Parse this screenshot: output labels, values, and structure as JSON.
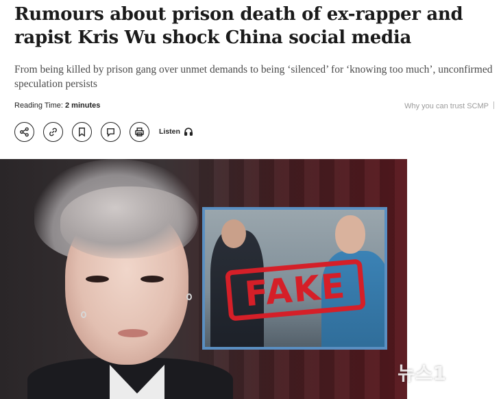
{
  "article": {
    "headline": "Rumours about prison death of ex-rapper and rapist Kris Wu shock China social media",
    "subheadline": "From being killed by prison gang over unmet demands to being ‘silenced’ for ‘knowing too much’, unconfirmed speculation persists",
    "reading_time_label": "Reading Time:",
    "reading_time_value": "2 minutes",
    "trust_link": "Why you can trust SCMP"
  },
  "toolbar": {
    "tools": [
      {
        "name": "share",
        "icon": "share-icon"
      },
      {
        "name": "copy-link",
        "icon": "link-icon"
      },
      {
        "name": "bookmark",
        "icon": "bookmark-icon"
      },
      {
        "name": "comment",
        "icon": "comment-icon"
      },
      {
        "name": "print",
        "icon": "printer-icon"
      }
    ],
    "listen_label": "Listen",
    "listen_icon": "headphones-icon"
  },
  "image": {
    "stamp_text": "FAKE",
    "watermark": "뉴스1"
  },
  "colors": {
    "stamp_red": "#d51f28",
    "inset_border": "#5a8fc2",
    "muted_text": "#9a9a9a"
  }
}
